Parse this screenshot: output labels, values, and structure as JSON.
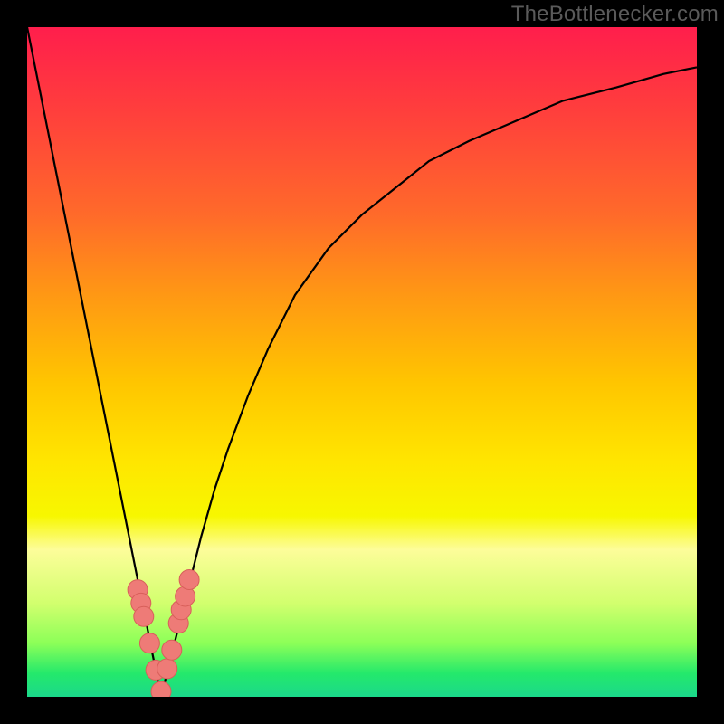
{
  "watermark": "TheBottlenecker.com",
  "chart_data": {
    "type": "line",
    "title": "",
    "xlabel": "",
    "ylabel": "",
    "xlim": [
      0,
      100
    ],
    "ylim": [
      0,
      100
    ],
    "notch_x": 20,
    "series": [
      {
        "name": "curve",
        "x": [
          0,
          2,
          4,
          6,
          8,
          10,
          12,
          14,
          16,
          18,
          19,
          20,
          21,
          22,
          24,
          26,
          28,
          30,
          33,
          36,
          40,
          45,
          50,
          55,
          60,
          66,
          73,
          80,
          88,
          95,
          100
        ],
        "values": [
          100,
          90,
          80,
          70,
          60,
          50,
          40,
          30,
          20,
          10,
          5,
          0,
          4,
          8,
          16,
          24,
          31,
          37,
          45,
          52,
          60,
          67,
          72,
          76,
          80,
          83,
          86,
          89,
          91,
          93,
          94
        ]
      }
    ],
    "markers": {
      "x": [
        16.5,
        17.0,
        17.4,
        18.3,
        19.2,
        20.0,
        20.9,
        21.6,
        22.6,
        23.0,
        23.6,
        24.2
      ],
      "values": [
        16.0,
        14.0,
        12.0,
        8.0,
        4.0,
        0.8,
        4.2,
        7.0,
        11.0,
        13.0,
        15.0,
        17.5
      ]
    },
    "colors": {
      "curve": "#000000",
      "marker_fill": "#ee7b77",
      "marker_stroke": "#d85f5a"
    }
  }
}
